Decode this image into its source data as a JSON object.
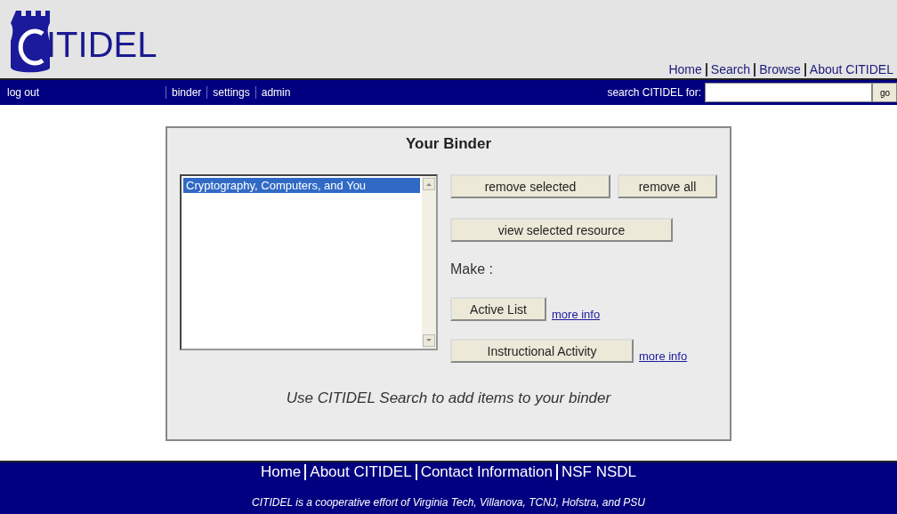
{
  "header": {
    "logo": "ITIDEL",
    "links": [
      "Home",
      "Search",
      "Browse",
      "About CITIDEL"
    ]
  },
  "navbar": {
    "left": "log out",
    "items": [
      "binder",
      "settings",
      "admin"
    ],
    "search_label": "search CITIDEL for:",
    "go_button": "go"
  },
  "binder": {
    "title": "Your Binder",
    "list": [
      {
        "label": "Cryptography, Computers, and You",
        "selected": true
      }
    ],
    "buttons": [
      "remove selected",
      "remove all",
      "view selected resource"
    ],
    "make_label": "Make :",
    "make": [
      {
        "button": "Active List",
        "link": "more info"
      },
      {
        "button": "Instructional Activity",
        "link": "more info"
      }
    ],
    "hint": "Use CITIDEL Search to add items to your binder"
  },
  "footer": {
    "links": [
      "Home",
      "About CITIDEL",
      "Contact Information",
      "NSF NSDL"
    ],
    "note": "CITIDEL is a cooperative effort of Virginia Tech, Villanova, TCNJ, Hofstra, and PSU"
  }
}
